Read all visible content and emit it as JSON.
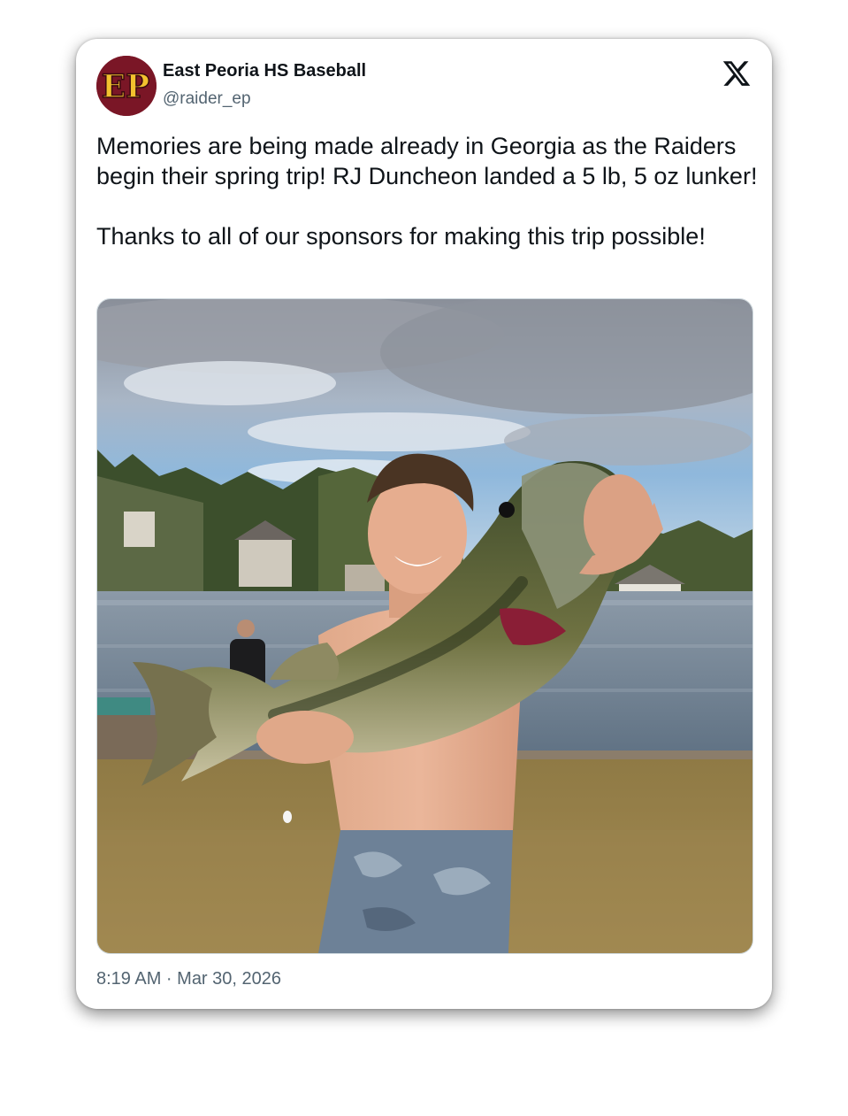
{
  "tweet": {
    "display_name": "East Peoria HS Baseball",
    "handle": "@raider_ep",
    "avatar_text": "EP",
    "text_paragraph_1": "Memories are being made already in Georgia as the Raiders begin their spring trip! RJ Duncheon landed a 5 lb, 5 oz lunker!",
    "text_paragraph_2": "Thanks to all of our sponsors for making this trip possible!",
    "timestamp": "8:19 AM · Mar 30, 2026",
    "platform_icon": "x-logo-icon",
    "media_description_icon": "photo-image"
  },
  "colors": {
    "avatar_bg": "#7a1626",
    "avatar_letters": "#f2c12e",
    "name_text": "#0f1419",
    "secondary_text": "#536471"
  }
}
